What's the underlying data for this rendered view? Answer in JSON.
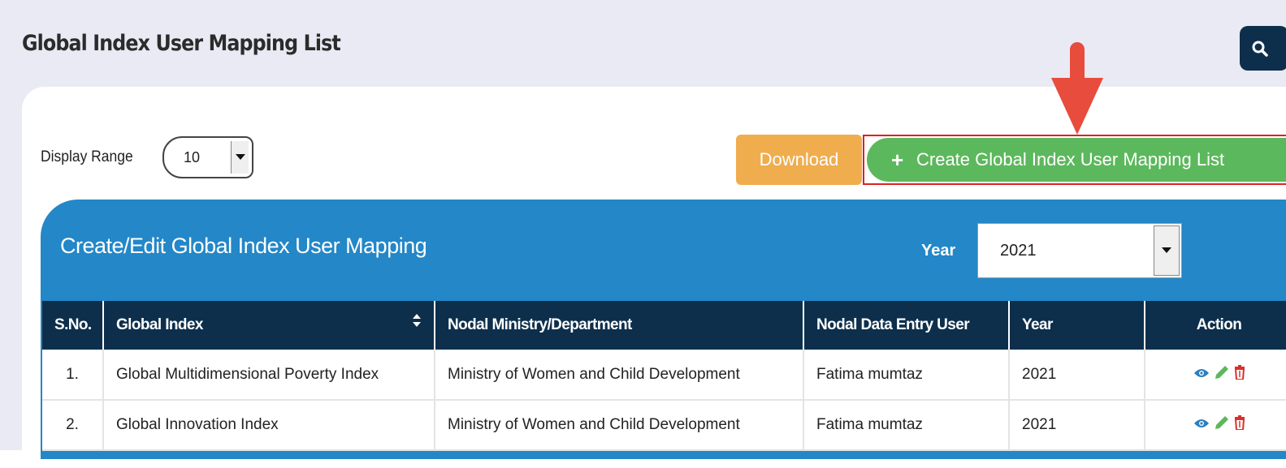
{
  "page": {
    "title": "Global Index User Mapping List"
  },
  "toolbar": {
    "display_range_label": "Display Range",
    "display_range_value": "10",
    "download_label": "Download",
    "create_label": "Create Global Index User Mapping List"
  },
  "panel": {
    "title": "Create/Edit Global Index User Mapping",
    "year_label": "Year",
    "year_value": "2021"
  },
  "table": {
    "headers": [
      "S.No.",
      "Global Index",
      "Nodal Ministry/Department",
      "Nodal Data Entry User",
      "Year",
      "Action"
    ],
    "rows": [
      [
        "1.",
        "Global Multidimensional Poverty Index",
        "Ministry of Women and Child Development",
        "Fatima mumtaz",
        "2021"
      ],
      [
        "2.",
        "Global Innovation Index",
        "Ministry of Women and Child Development",
        "Fatima mumtaz",
        "2021"
      ]
    ]
  },
  "colors": {
    "header_navy": "#0d2f4c",
    "panel_blue": "#2387c8",
    "download_orange": "#f0ad4e",
    "create_green": "#5cb85c",
    "annotation_red": "#e74c3c",
    "view_icon": "#2a7fc1",
    "edit_icon": "#5cb85c",
    "delete_icon": "#d9302c"
  },
  "icons": [
    "search-icon",
    "plus-icon",
    "chevron-down-icon",
    "sort-icon",
    "eye-icon",
    "pencil-icon",
    "trash-icon",
    "arrow-annotation"
  ]
}
